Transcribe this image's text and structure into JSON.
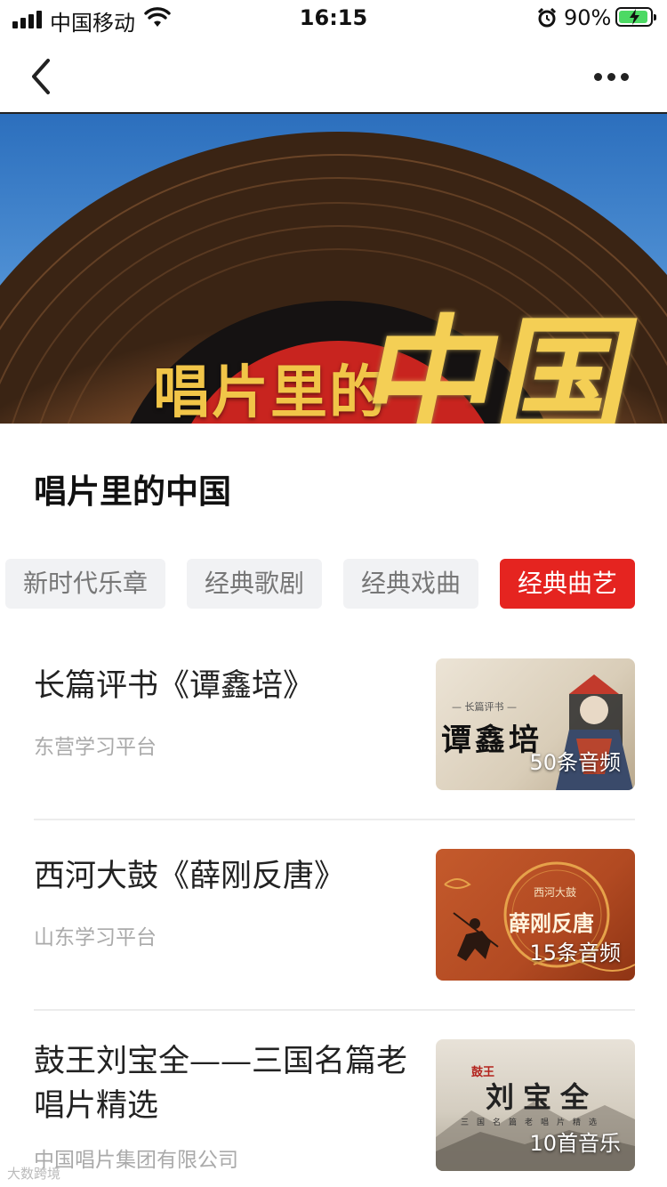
{
  "status_bar": {
    "carrier": "中国移动",
    "time": "16:15",
    "battery_percent": "90%"
  },
  "nav": {
    "back_icon": "chevron-left-icon",
    "more_icon": "more-dots-icon"
  },
  "banner": {
    "title_text": "唱片里的",
    "logo_text": "中国"
  },
  "page_title": "唱片里的中国",
  "tabs": [
    {
      "label": "新时代乐章",
      "active": false
    },
    {
      "label": "经典歌剧",
      "active": false
    },
    {
      "label": "经典戏曲",
      "active": false
    },
    {
      "label": "经典曲艺",
      "active": true
    }
  ],
  "colors": {
    "accent": "#e52420",
    "tab_bg": "#f1f2f4"
  },
  "items": [
    {
      "title": "长篇评书《谭鑫培》",
      "source": "东营学习平台",
      "thumb_kicker": "— 长篇评书 —",
      "thumb_title": "谭鑫培",
      "count": "50条音频"
    },
    {
      "title": "西河大鼓《薛刚反唐》",
      "source": "山东学习平台",
      "thumb_kicker": "西河大鼓",
      "thumb_title": "薛刚反唐",
      "count": "15条音频"
    },
    {
      "title": "鼓王刘宝全——三国名篇老唱片精选",
      "source": "中国唱片集团有限公司",
      "thumb_kicker": "鼓王",
      "thumb_title": "刘宝全",
      "thumb_subtitle": "三国名篇老唱片精选",
      "count": "10首音乐"
    }
  ],
  "watermark": "大数跨境"
}
